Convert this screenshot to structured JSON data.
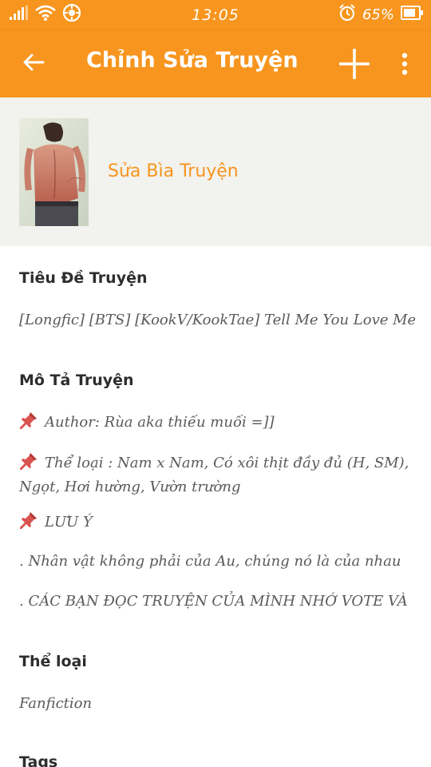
{
  "status_bar": {
    "time": "13:05",
    "battery_percent": "65%",
    "icons": [
      "signal-icon",
      "wifi-icon",
      "hotspot-icon",
      "alarm-icon",
      "battery-icon"
    ]
  },
  "app_bar": {
    "title": "Chỉnh Sửa Truyện",
    "icons": [
      "back-arrow-icon",
      "plus-icon",
      "more-vertical-icon"
    ]
  },
  "cover": {
    "edit_label": "Sửa Bìa Truyện"
  },
  "title_field": {
    "label": "Tiêu Đề Truyện",
    "value": "[Longfic] [BTS] [KookV/KookTae] Tell Me You Love Me"
  },
  "description": {
    "label": "Mô Tả Truyện",
    "lines": [
      "Author: Rùa aka thiếu muối =]]",
      "Thể loại : Nam x Nam, Có xôi thịt đầy đủ (H, SM), Ngọt, Hơi hường, Vườn trường",
      "LƯU Ý",
      ". Nhân vật không phải của Au, chúng nó là của nhau",
      ". CÁC BẠN ĐỌC TRUYỆN CỦA MÌNH NHỚ VOTE VÀ"
    ]
  },
  "genre": {
    "label": "Thể loại",
    "value": "Fanfiction"
  },
  "tags": {
    "label": "Tags"
  },
  "colors": {
    "accent": "#f7951e",
    "cover_bg": "#f2f2ee",
    "text_dark": "#2d2d2d",
    "text_muted": "#5a5a5a"
  }
}
